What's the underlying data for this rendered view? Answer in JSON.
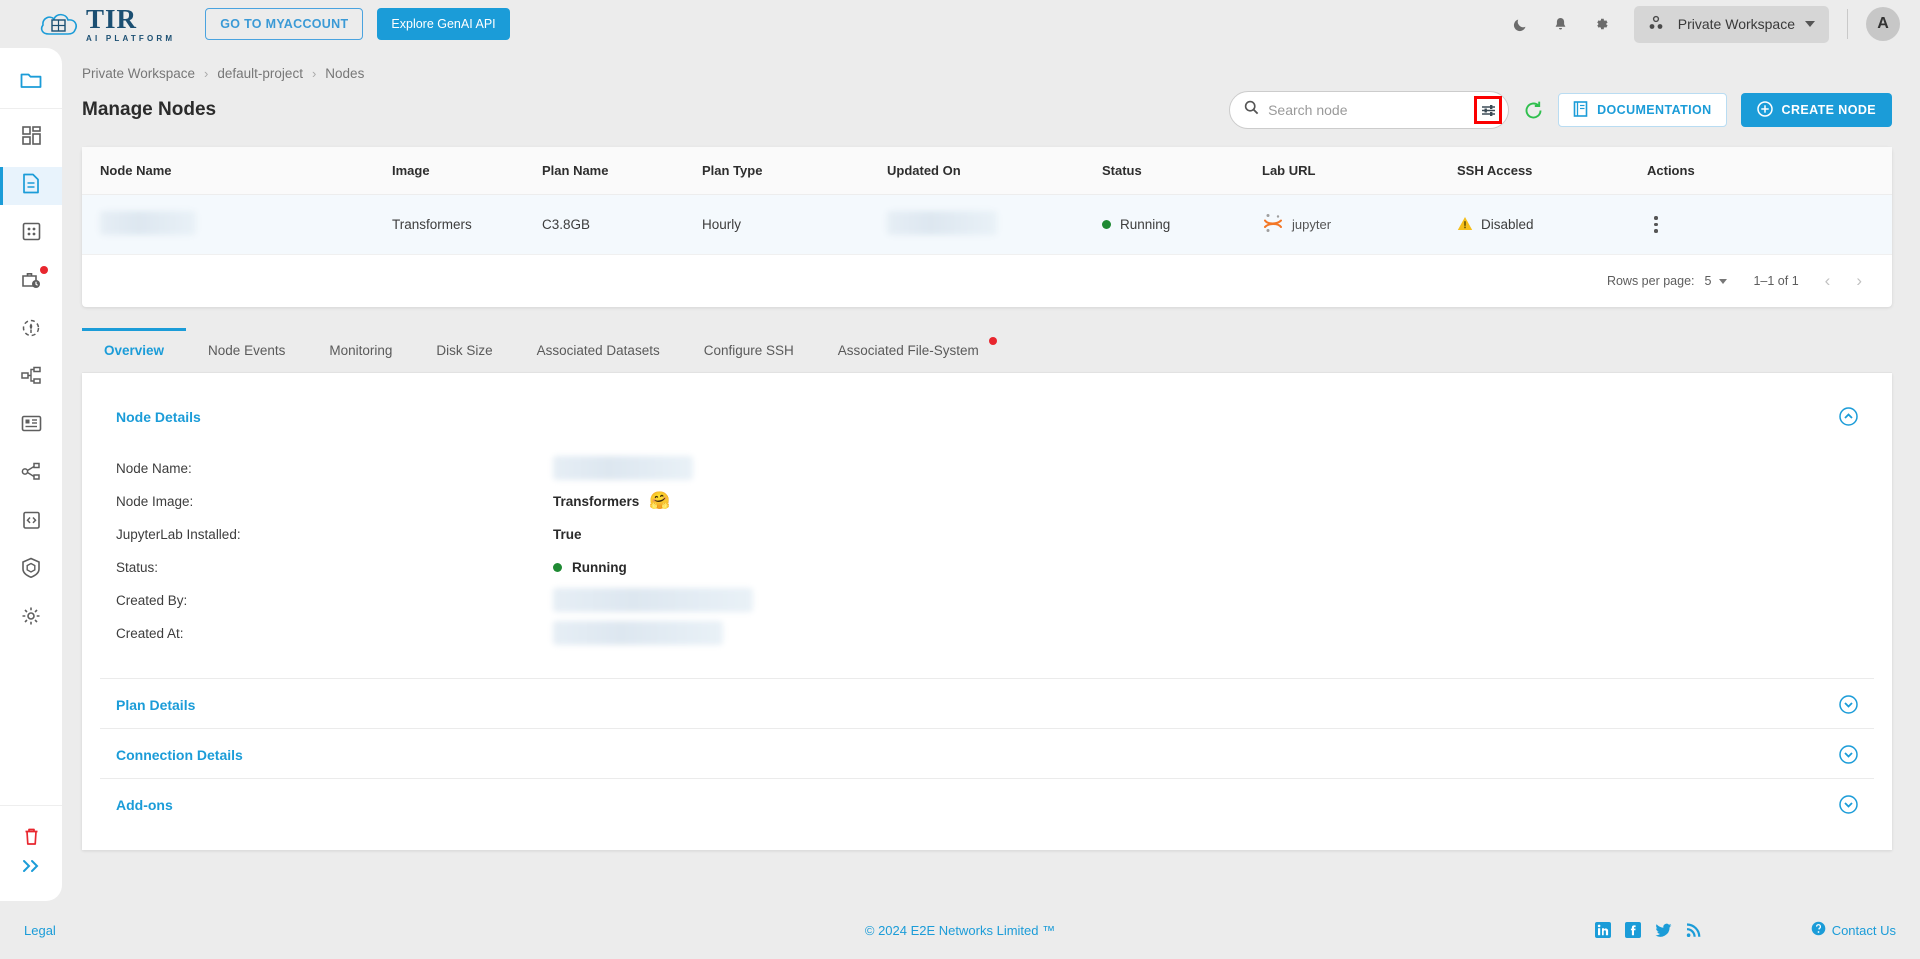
{
  "topbar": {
    "logo_title": "TIR",
    "logo_subtitle": "AI PLATFORM",
    "myaccount_label": "GO TO MYACCOUNT",
    "genai_label": "Explore GenAI API",
    "dark_mode_icon": "moon-icon",
    "notifications_icon": "bell-icon",
    "settings_icon": "gear-icon",
    "workspace_label": "Private Workspace",
    "avatar_initial": "A"
  },
  "sidebar": {
    "top_icon": "folder-icon",
    "items": [
      {
        "icon": "dashboard-icon",
        "name": "dashboard",
        "active": false,
        "badge": false
      },
      {
        "icon": "document-icon",
        "name": "nodes",
        "active": true,
        "badge": false
      },
      {
        "icon": "grid-icon",
        "name": "datasets",
        "active": false,
        "badge": false
      },
      {
        "icon": "briefcase-clock-icon",
        "name": "jobs",
        "active": false,
        "badge": true
      },
      {
        "icon": "rocket-icon",
        "name": "inference",
        "active": false,
        "badge": false
      },
      {
        "icon": "pipeline-icon",
        "name": "pipelines",
        "active": false,
        "badge": false
      },
      {
        "icon": "server-icon",
        "name": "models",
        "active": false,
        "badge": false
      },
      {
        "icon": "share-nodes-icon",
        "name": "endpoints",
        "active": false,
        "badge": false
      },
      {
        "icon": "code-clipboard-icon",
        "name": "api",
        "active": false,
        "badge": false
      },
      {
        "icon": "cube-shield-icon",
        "name": "containers",
        "active": false,
        "badge": false
      },
      {
        "icon": "settings-gear-icon",
        "name": "settings",
        "active": false,
        "badge": false
      }
    ],
    "trash_icon": "trash-icon",
    "expand_icon": "chevrons-right-icon"
  },
  "breadcrumb": {
    "items": [
      "Private Workspace",
      "default-project",
      "Nodes"
    ],
    "separator": "›"
  },
  "page": {
    "title": "Manage Nodes"
  },
  "search": {
    "placeholder": "Search node",
    "value": "",
    "icon": "search-icon"
  },
  "toolbar": {
    "filter_icon": "filter-sliders-icon",
    "filter_highlight_color": "#fb0000",
    "refresh_icon": "refresh-icon",
    "documentation_label": "DOCUMENTATION",
    "documentation_icon": "book-icon",
    "create_node_label": "CREATE NODE",
    "create_node_icon": "plus-circle-icon"
  },
  "table": {
    "columns": [
      "Node Name",
      "Image",
      "Plan Name",
      "Plan Type",
      "Updated On",
      "Status",
      "Lab URL",
      "SSH Access",
      "Actions"
    ],
    "rows": [
      {
        "node_name": "",
        "node_name_redacted": true,
        "image": "Transformers",
        "plan_name": "C3.8GB",
        "plan_type": "Hourly",
        "updated_on": "",
        "updated_on_redacted": true,
        "status": "Running",
        "status_color": "#1f8a33",
        "lab_url": "jupyter",
        "lab_url_icon": "jupyter-icon",
        "ssh_access": "Disabled",
        "ssh_icon": "warning-triangle-icon",
        "actions_icon": "kebab-menu-icon"
      }
    ]
  },
  "pagination": {
    "rows_per_page_label": "Rows per page:",
    "rows_per_page_value": "5",
    "range_label": "1–1 of 1",
    "prev_icon": "chevron-left-icon",
    "next_icon": "chevron-right-icon"
  },
  "tabs": [
    {
      "label": "Overview",
      "active": true,
      "badge": false
    },
    {
      "label": "Node Events",
      "active": false,
      "badge": false
    },
    {
      "label": "Monitoring",
      "active": false,
      "badge": false
    },
    {
      "label": "Disk Size",
      "active": false,
      "badge": false
    },
    {
      "label": "Associated Datasets",
      "active": false,
      "badge": false
    },
    {
      "label": "Configure SSH",
      "active": false,
      "badge": false
    },
    {
      "label": "Associated File-System",
      "active": false,
      "badge": true
    }
  ],
  "details": {
    "node_details": {
      "title": "Node Details",
      "expanded": true,
      "toggle_icon": "circle-chevron-up-icon",
      "fields": [
        {
          "label": "Node Name:",
          "value": "",
          "redacted": true,
          "redact_width": 140
        },
        {
          "label": "Node Image:",
          "value": "Transformers",
          "emoji": "🤗",
          "redacted": false
        },
        {
          "label": "JupyterLab Installed:",
          "value": "True",
          "redacted": false
        },
        {
          "label": "Status:",
          "value": "Running",
          "status_dot": "#1f8a33",
          "redacted": false
        },
        {
          "label": "Created By:",
          "value": "",
          "redacted": true,
          "redact_width": 200
        },
        {
          "label": "Created At:",
          "value": "",
          "redacted": true,
          "redact_width": 170
        }
      ]
    },
    "sections": [
      {
        "title": "Plan Details",
        "expanded": false,
        "toggle_icon": "circle-chevron-down-icon"
      },
      {
        "title": "Connection Details",
        "expanded": false,
        "toggle_icon": "circle-chevron-down-icon"
      },
      {
        "title": "Add-ons",
        "expanded": false,
        "toggle_icon": "circle-chevron-down-icon"
      }
    ]
  },
  "footer": {
    "legal": "Legal",
    "copyright": "© 2024 E2E Networks Limited ™",
    "social": [
      "linkedin-icon",
      "facebook-icon",
      "twitter-icon",
      "rss-icon"
    ],
    "contact": "Contact Us",
    "contact_icon": "help-circle-icon"
  },
  "colors": {
    "accent": "#1b9cd8",
    "danger": "#e8262e",
    "success": "#1f8a33",
    "warning": "#f5bf1b"
  }
}
